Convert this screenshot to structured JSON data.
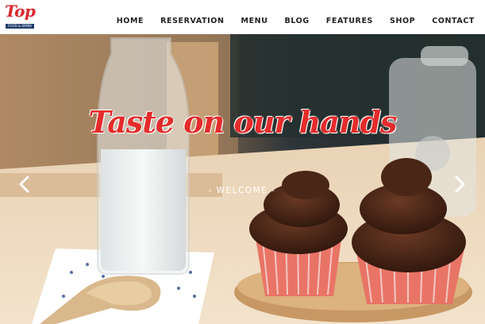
{
  "logo": {
    "script": "Top",
    "tagline": "FOOD & DRINK"
  },
  "nav": {
    "items": [
      "HOME",
      "RESERVATION",
      "MENU",
      "BLOG",
      "FEATURES",
      "SHOP",
      "CONTACT"
    ]
  },
  "hero": {
    "headline": "Taste on our hands",
    "subheading": "- WELCOME -"
  },
  "icons": {
    "prev": "chevron-left-icon",
    "next": "chevron-right-icon"
  },
  "colors": {
    "accent": "#e52b2b",
    "brand": "#d9262c"
  }
}
